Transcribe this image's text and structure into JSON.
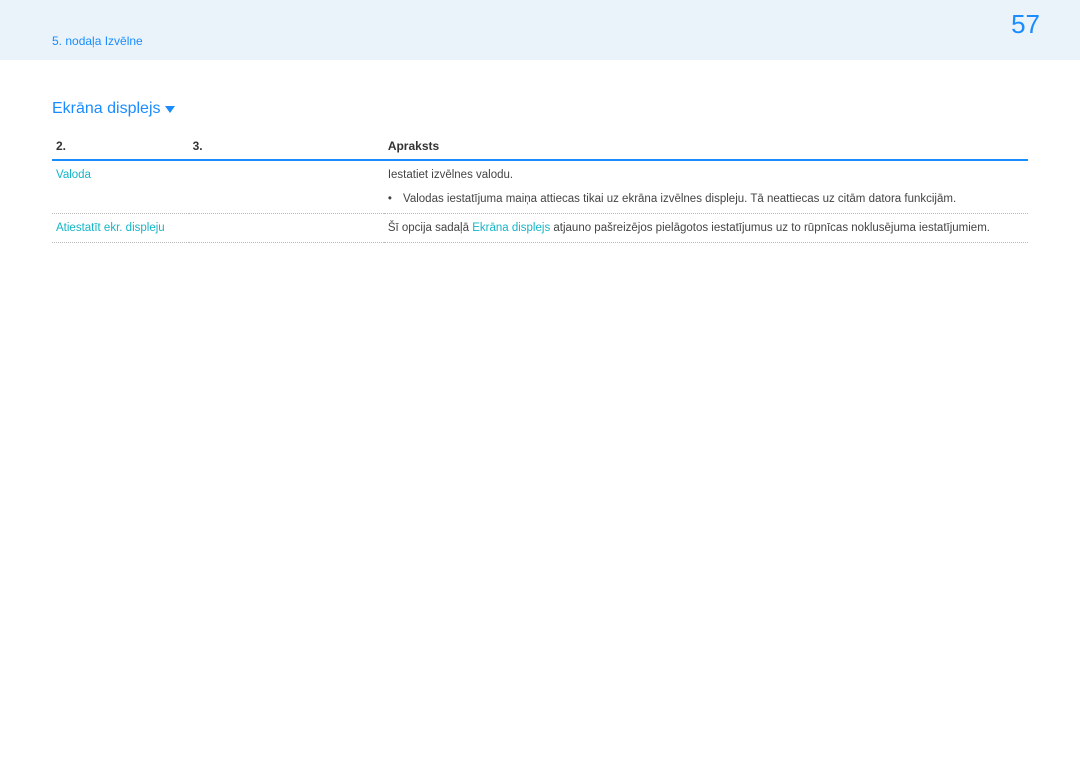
{
  "header": {
    "breadcrumb": "5. nodaļa Izvēlne",
    "page_number": "57"
  },
  "section": {
    "title": "Ekrāna displejs"
  },
  "table": {
    "headers": {
      "col1": "2.",
      "col2": "3.",
      "col3": "Apraksts"
    },
    "rows": {
      "r1_col1": "Valoda",
      "r1_col3": "Iestatiet izvēlnes valodu.",
      "r1b_col3": "Valodas iestatījuma maiņa attiecas tikai uz ekrāna izvēlnes displeju. Tā neattiecas uz citām datora funkcijām.",
      "r2_col1": "Atiestatīt ekr. displeju",
      "r2_col3_pre": "Šī opcija sadaļā ",
      "r2_col3_link": "Ekrāna displejs",
      "r2_col3_post": " atjauno pašreizējos pielāgotos iestatījumus uz to rūpnīcas noklusējuma iestatījumiem."
    }
  }
}
